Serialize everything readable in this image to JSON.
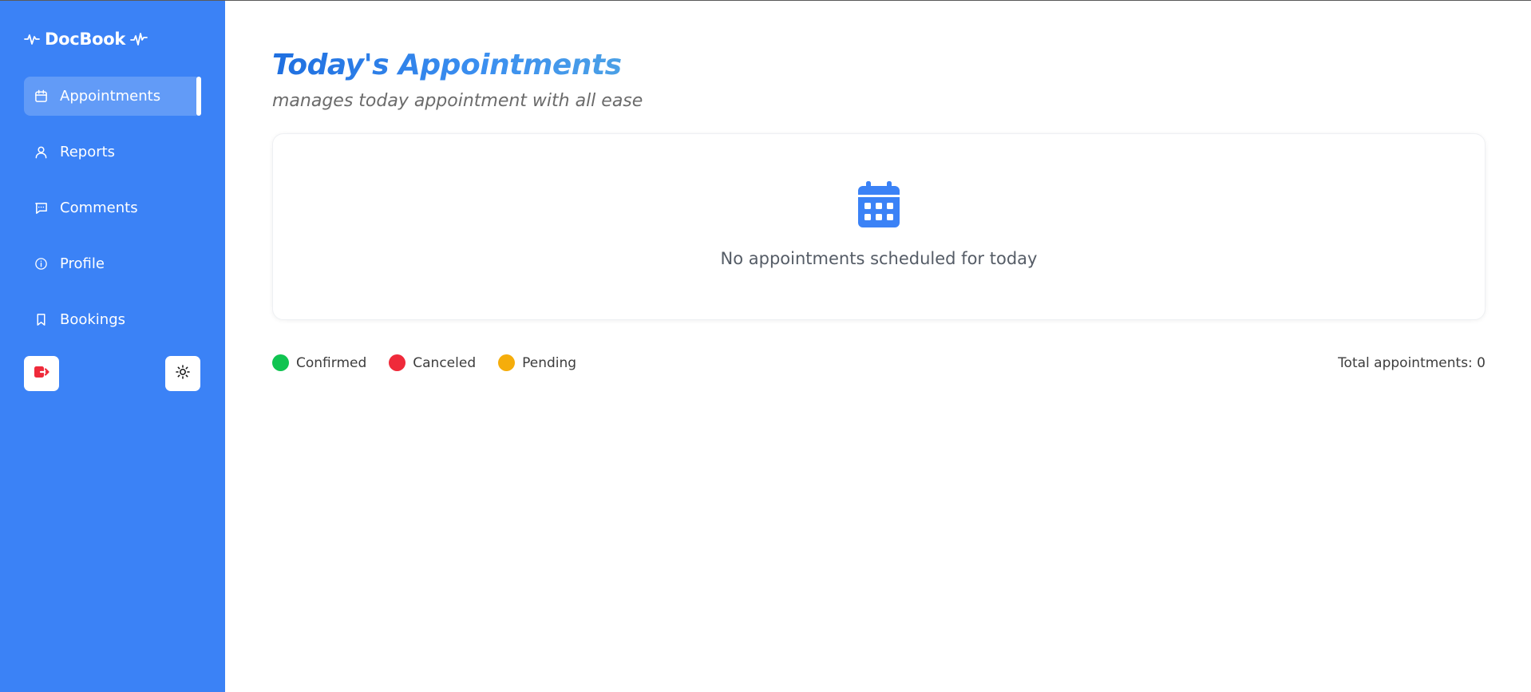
{
  "brand": {
    "name": "DocBook",
    "left_icon": "heartbeat-icon",
    "right_icon": "heartbeat-icon"
  },
  "sidebar": {
    "items": [
      {
        "label": "Appointments",
        "icon": "calendar-icon",
        "active": true
      },
      {
        "label": "Reports",
        "icon": "user-icon",
        "active": false
      },
      {
        "label": "Comments",
        "icon": "comment-icon",
        "active": false
      },
      {
        "label": "Profile",
        "icon": "info-icon",
        "active": false
      },
      {
        "label": "Bookings",
        "icon": "bookmark-icon",
        "active": false
      }
    ],
    "logout_icon": "logout-icon",
    "theme_icon": "sun-icon"
  },
  "main": {
    "title": "Today's Appointments",
    "subtitle": "manages today appointment with all ease",
    "empty_state": {
      "icon": "calendar-icon",
      "message": "No appointments scheduled for today"
    },
    "legend": [
      {
        "label": "Confirmed",
        "color": "#10c451"
      },
      {
        "label": "Canceled",
        "color": "#ef2a3a"
      },
      {
        "label": "Pending",
        "color": "#f5ad0b"
      }
    ],
    "total": "Total appointments: 0"
  },
  "colors": {
    "sidebar": "#3b82f6",
    "accent": "#3b82f6",
    "logout": "#ef2a3a"
  }
}
